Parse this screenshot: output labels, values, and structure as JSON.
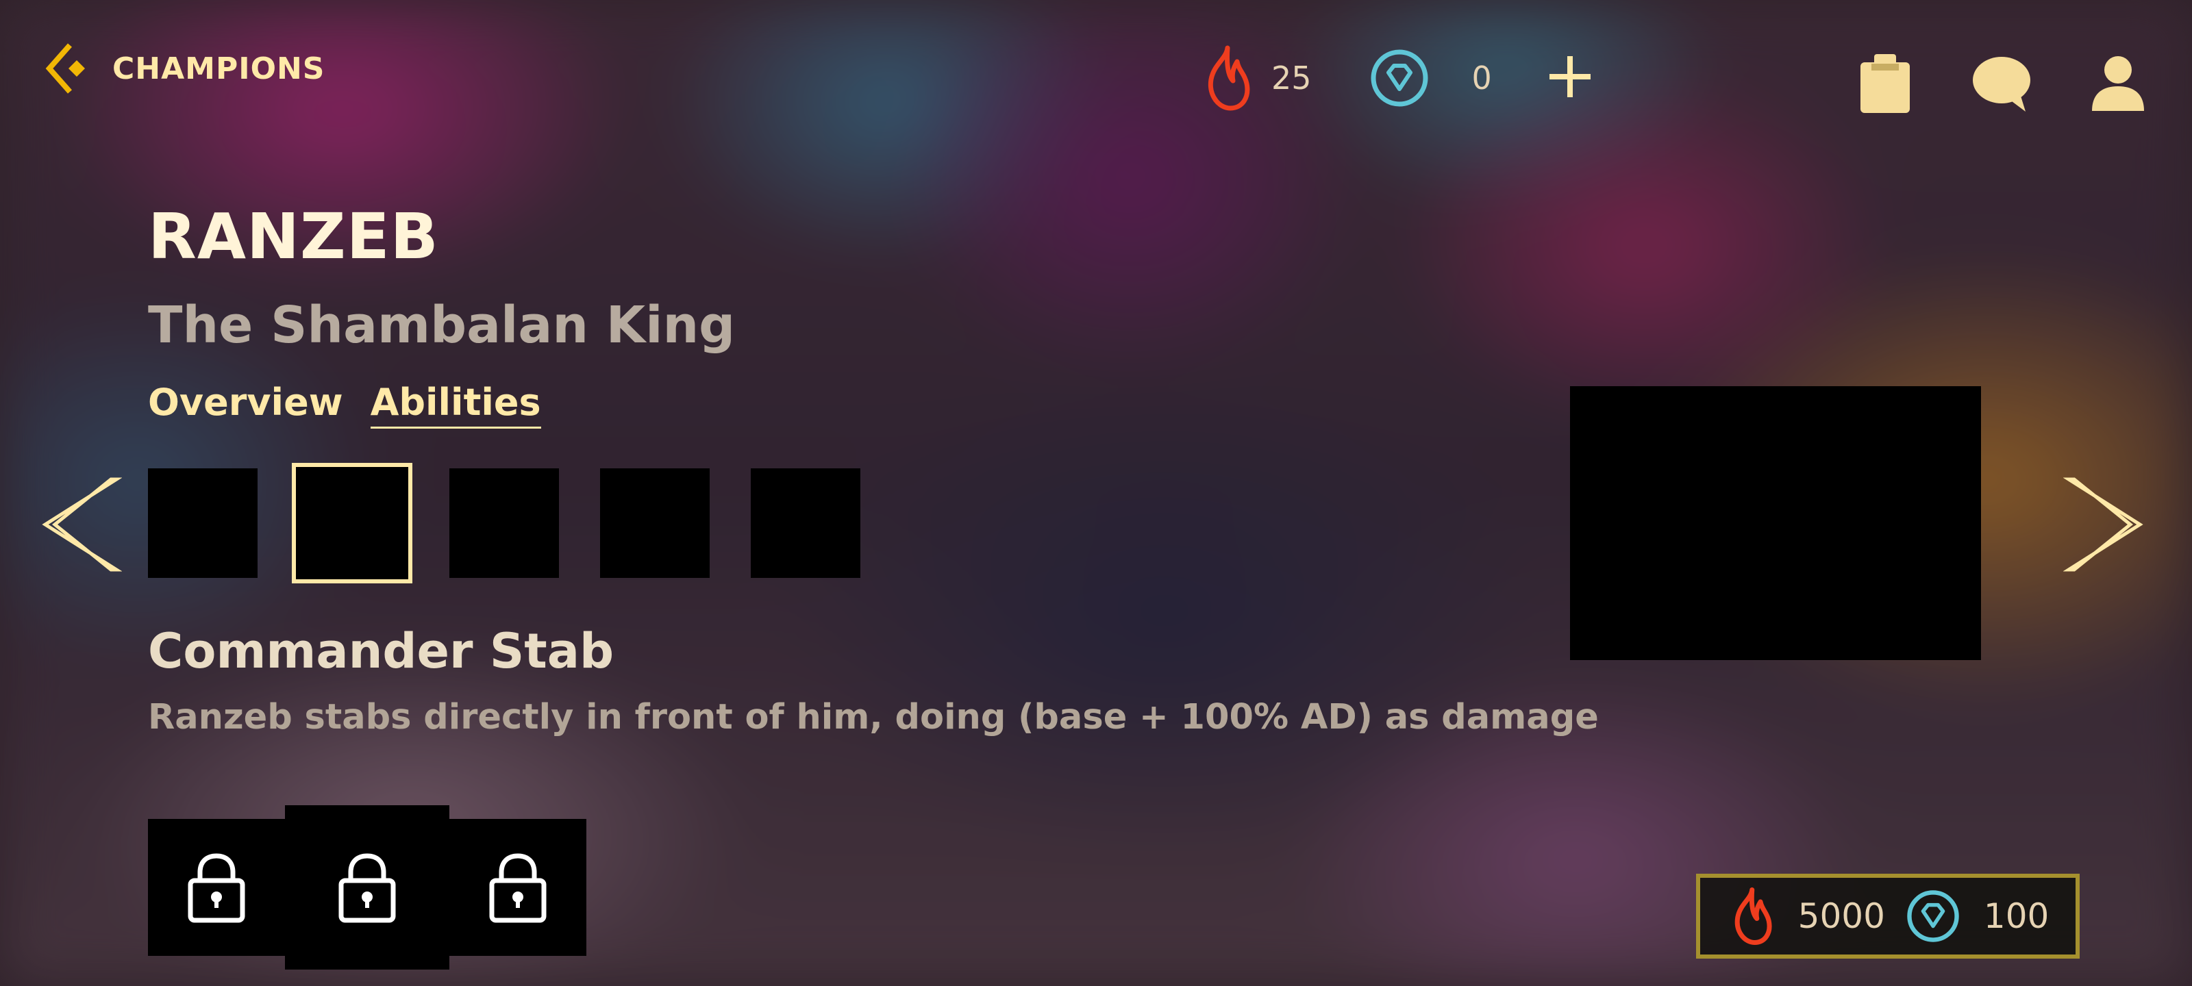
{
  "nav": {
    "back_label": "CHAMPIONS",
    "accent_color": "#f2b705"
  },
  "currency": {
    "flame_amount": "25",
    "gem_amount": "0",
    "flame_color": "#ef3d1e",
    "gem_color": "#5fc6d6"
  },
  "header_icons": [
    "add-icon",
    "clipboard-icon",
    "chat-icon",
    "profile-icon"
  ],
  "champion": {
    "name": "RANZEB",
    "title": "The Shambalan King"
  },
  "tabs": [
    {
      "label": "Overview",
      "active": false
    },
    {
      "label": "Abilities",
      "active": true
    }
  ],
  "abilities": {
    "count": 5,
    "selected_index": 1,
    "selected_name": "Commander Stab",
    "selected_description": "Ranzeb stabs directly in front of him, doing (base + 100% AD) as damage"
  },
  "skins": [
    {
      "locked": true
    },
    {
      "locked": true,
      "selected": true
    },
    {
      "locked": true
    }
  ],
  "unlock_cost": {
    "flame": "5000",
    "gem": "100"
  }
}
